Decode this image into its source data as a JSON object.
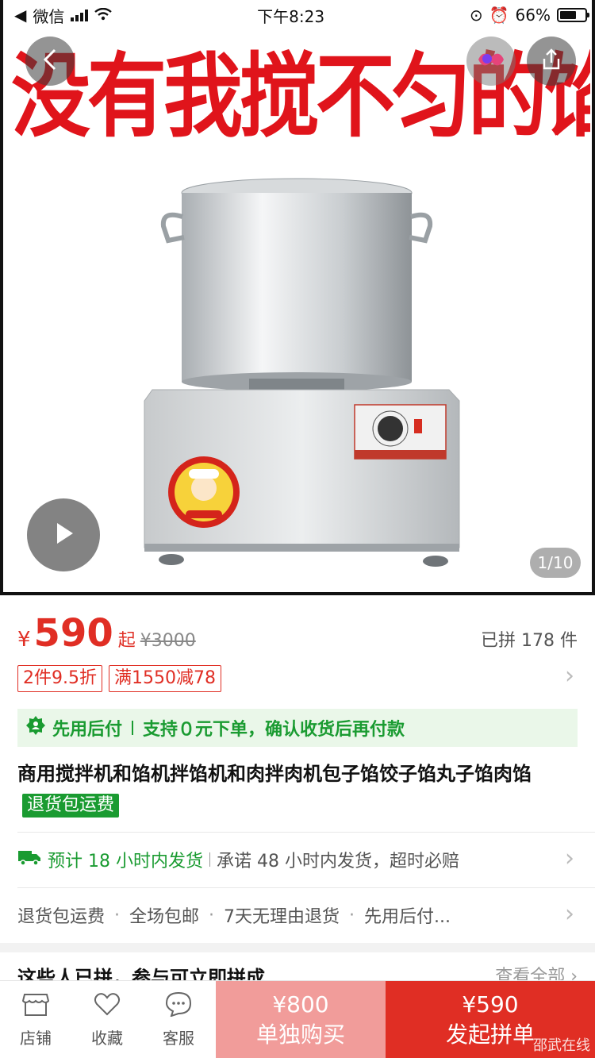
{
  "status_bar": {
    "back_app": "微信",
    "time": "下午8:23",
    "battery": "66%"
  },
  "hero": {
    "banner_text": "没有我搅不匀的馅",
    "page_indicator": "1/10",
    "icons": [
      "back-icon",
      "share-icon",
      "play-icon"
    ]
  },
  "price": {
    "currency": "¥",
    "value": "590",
    "suffix": "起",
    "original": "¥3000",
    "sold": "已拼 178 件"
  },
  "coupons": [
    "2件9.5折",
    "满1550减78"
  ],
  "pay_later": {
    "label": "先用后付",
    "desc": "支持０元下单，确认收货后再付款"
  },
  "product": {
    "title": "商用搅拌机和馅机拌馅机和肉拌肉机包子馅饺子馅丸子馅肉馅",
    "tag": "退货包运费"
  },
  "shipping": {
    "estimate": "预计 18 小时内发货",
    "promise": "承诺 48 小时内发货，超时必赔"
  },
  "services": [
    "退货包运费",
    "全场包邮",
    "7天无理由退货",
    "先用后付..."
  ],
  "group": {
    "heading": "这些人已拼，参与可立即拼成",
    "more": "查看全部 ›"
  },
  "bottom": {
    "tabs": [
      {
        "label": "店铺",
        "icon": "store-icon"
      },
      {
        "label": "收藏",
        "icon": "heart-icon"
      },
      {
        "label": "客服",
        "icon": "chat-icon"
      }
    ],
    "solo_price": "¥800",
    "solo_label": "单独购买",
    "group_price": "¥590",
    "group_label": "发起拼单"
  },
  "watermark": "邵武在线",
  "colors": {
    "accent": "#e02e24",
    "green": "#1a9b31",
    "solo": "#f19c9a"
  }
}
